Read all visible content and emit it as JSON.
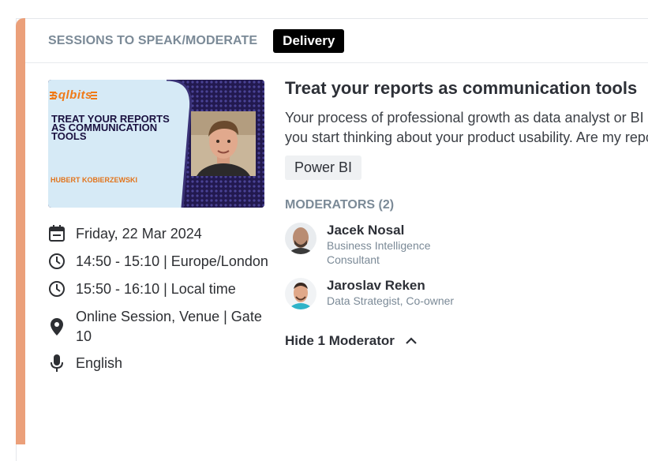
{
  "header": {
    "section_label": "SESSIONS TO SPEAK/MODERATE",
    "badge": "Delivery"
  },
  "thumbnail": {
    "logo": "sqlbits",
    "title": "TREAT YOUR REPORTS AS COMMUNICATION TOOLS",
    "speaker": "HUBERT KOBIERZEWSKI"
  },
  "info": {
    "date": "Friday, 22 Mar 2024",
    "time_venue": "14:50 - 15:10 | Europe/London",
    "time_local": "15:50 - 16:10 | Local time",
    "location_line1": "Online Session, Venue | Gate",
    "location_line2": "10",
    "language": "English"
  },
  "session": {
    "title": "Treat your reports as communication tools",
    "desc_line1": "Your process of professional growth as data analyst or BI de",
    "desc_line2": "you start thinking about your product usability. Are my repor",
    "tag": "Power BI"
  },
  "moderators": {
    "label": "MODERATORS (2)",
    "items": [
      {
        "name": "Jacek Nosal",
        "role": "Business Intelligence Consultant"
      },
      {
        "name": "Jaroslav Reken",
        "role": "Data Strategist, Co-owner"
      }
    ],
    "toggle": "Hide 1 Moderator"
  },
  "colors": {
    "accent": "#eba07a",
    "badge_bg": "#000000",
    "muted": "#7b8a97",
    "thumb_dark": "#22194f",
    "thumb_light": "#d6eaf6",
    "thumb_orange": "#f07a16"
  },
  "icons": [
    "calendar-icon",
    "clock-icon",
    "clock-icon",
    "location-pin-icon",
    "microphone-icon",
    "chevron-up-icon"
  ]
}
